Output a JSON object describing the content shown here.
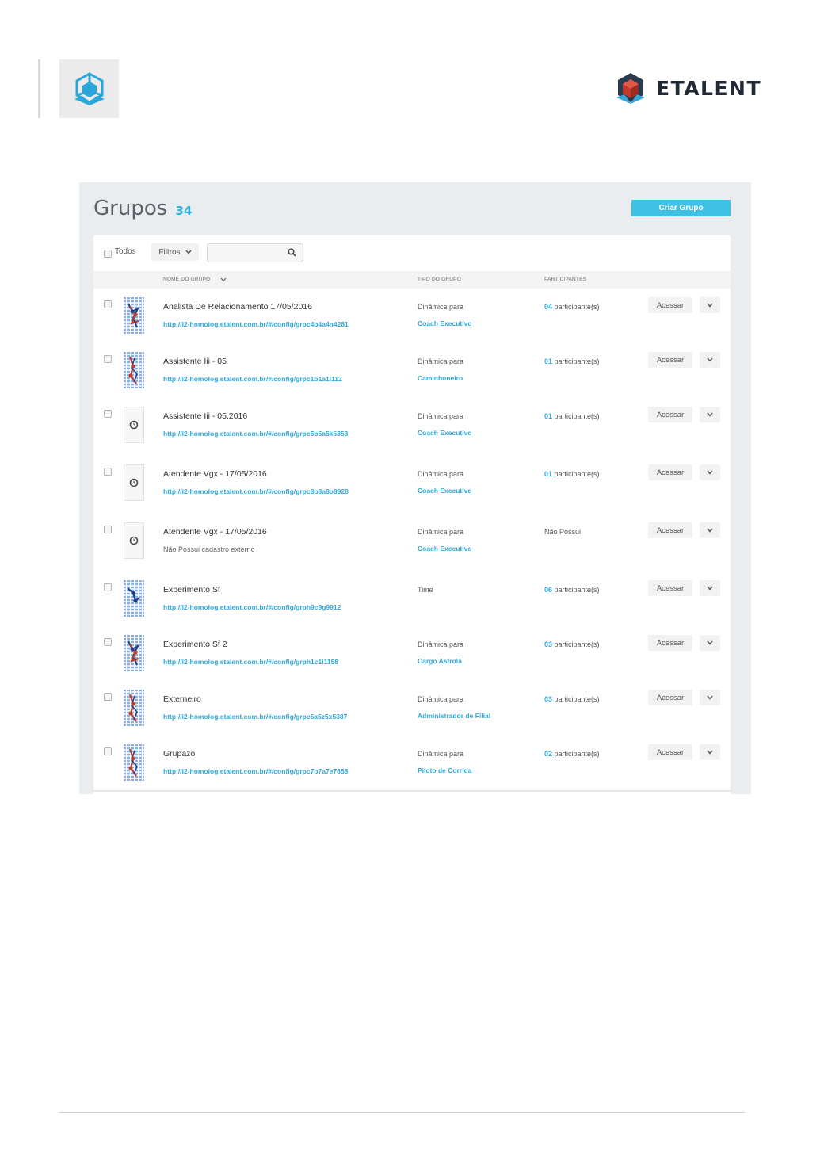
{
  "brand": {
    "name": "ETALENT"
  },
  "page": {
    "title": "Grupos",
    "count": "34",
    "create_button": "Criar Grupo",
    "filters": {
      "all_label": "Todos",
      "filter_label": "Filtros",
      "search_placeholder": ""
    },
    "columns": {
      "name": "NOME DO GRUPO",
      "type": "TIPO DO GRUPO",
      "participants": "PARTICIPANTES"
    },
    "access_label": "Acessar",
    "groups": [
      {
        "name": "Analista De Relacionamento 17/05/2016",
        "link": "http://i2-homolog.etalent.com.br/#/config/grpc4b4a4n4281",
        "type_line1": "Dinâmica para",
        "type_line2": "Coach Executivo",
        "participants_num": "04",
        "participants_text": " participante(s)",
        "thumb": "chart-blue-red"
      },
      {
        "name": "Assistente Iii - 05",
        "link": "http://i2-homolog.etalent.com.br/#/config/grpc1b1a1l112",
        "type_line1": "Dinâmica para",
        "type_line2": "Caminhoneiro",
        "participants_num": "01",
        "participants_text": " participante(s)",
        "thumb": "chart-red"
      },
      {
        "name": "Assistente Iii - 05.2016",
        "link": "http://i2-homolog.etalent.com.br/#/config/grpc5b5a5k5353",
        "type_line1": "Dinâmica para",
        "type_line2": "Coach Executivo",
        "participants_num": "01",
        "participants_text": " participante(s)",
        "thumb": "clock"
      },
      {
        "name": "Atendente Vgx - 17/05/2016",
        "link": "http://i2-homolog.etalent.com.br/#/config/grpc8b8a8o8928",
        "type_line1": "Dinâmica para",
        "type_line2": "Coach Executivo",
        "participants_num": "01",
        "participants_text": " participante(s)",
        "thumb": "clock"
      },
      {
        "name": "Atendente Vgx - 17/05/2016",
        "sub": "Não Possui cadastro externo",
        "type_line1": "Dinâmica para",
        "type_line2": "Coach Executivo",
        "participants_plain": "Não Possui",
        "thumb": "clock"
      },
      {
        "name": "Experimento Sf",
        "link": "http://i2-homolog.etalent.com.br/#/config/grph9c9g9912",
        "type_line1": "Time",
        "type_line2": "",
        "participants_num": "06",
        "participants_text": " participante(s)",
        "thumb": "chart-blue"
      },
      {
        "name": "Experimento Sf 2",
        "link": "http://i2-homolog.etalent.com.br/#/config/grph1c1i1158",
        "type_line1": "Dinâmica para",
        "type_line2": "Cargo Astrolã",
        "participants_num": "03",
        "participants_text": " participante(s)",
        "thumb": "chart-blue-red"
      },
      {
        "name": "Externeiro",
        "link": "http://i2-homolog.etalent.com.br/#/config/grpc5a5z5x5387",
        "type_line1": "Dinâmica para",
        "type_line2": "Administrador de Filial",
        "participants_num": "03",
        "participants_text": " participante(s)",
        "thumb": "chart-red"
      },
      {
        "name": "Grupazo",
        "link": "http://i2-homolog.etalent.com.br/#/config/grpc7b7a7e7658",
        "type_line1": "Dinâmica para",
        "type_line2": "Piloto de Corrida",
        "participants_num": "02",
        "participants_text": " participante(s)",
        "thumb": "chart-red"
      }
    ]
  },
  "colors": {
    "accent": "#3fc1e6",
    "link": "#2ea9d9",
    "brand_dark": "#222a36",
    "brand_red": "#c0392b"
  }
}
